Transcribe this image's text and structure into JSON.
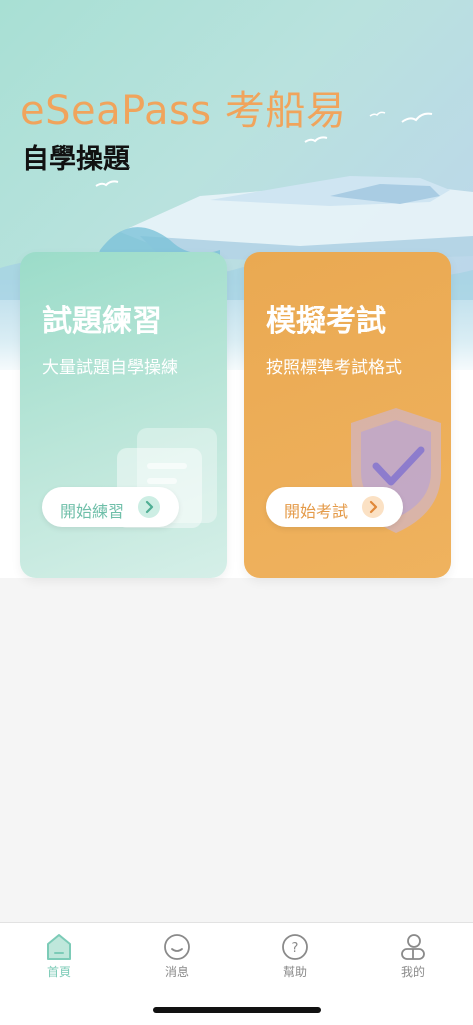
{
  "header": {
    "brand": "eSeaPass 考船易",
    "subtitle": "自學操題"
  },
  "cards": {
    "practice": {
      "title": "試題練習",
      "description": "大量試題自學操練",
      "button_label": "開始練習"
    },
    "exam": {
      "title": "模擬考試",
      "description": "按照標準考試格式",
      "button_label": "開始考試"
    }
  },
  "tabbar": {
    "items": [
      {
        "label": "首頁",
        "icon": "home-icon",
        "active": true
      },
      {
        "label": "消息",
        "icon": "message-icon",
        "active": false
      },
      {
        "label": "幫助",
        "icon": "help-icon",
        "active": false
      },
      {
        "label": "我的",
        "icon": "profile-icon",
        "active": false
      }
    ]
  },
  "colors": {
    "brand": "#f0a45c",
    "practice_card": "#9bdcc9",
    "exam_card": "#eaa952",
    "tab_active": "#7ccbb7",
    "tab_inactive": "#8a8a8a"
  }
}
